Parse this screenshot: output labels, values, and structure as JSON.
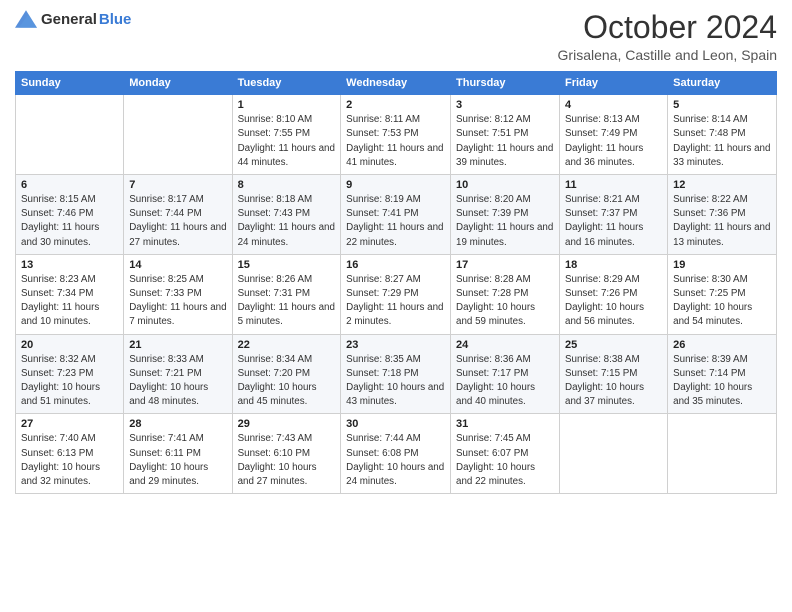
{
  "header": {
    "logo_general": "General",
    "logo_blue": "Blue",
    "month_title": "October 2024",
    "location": "Grisalena, Castille and Leon, Spain"
  },
  "weekdays": [
    "Sunday",
    "Monday",
    "Tuesday",
    "Wednesday",
    "Thursday",
    "Friday",
    "Saturday"
  ],
  "weeks": [
    [
      {
        "day": "",
        "info": ""
      },
      {
        "day": "",
        "info": ""
      },
      {
        "day": "1",
        "info": "Sunrise: 8:10 AM\nSunset: 7:55 PM\nDaylight: 11 hours and 44 minutes."
      },
      {
        "day": "2",
        "info": "Sunrise: 8:11 AM\nSunset: 7:53 PM\nDaylight: 11 hours and 41 minutes."
      },
      {
        "day": "3",
        "info": "Sunrise: 8:12 AM\nSunset: 7:51 PM\nDaylight: 11 hours and 39 minutes."
      },
      {
        "day": "4",
        "info": "Sunrise: 8:13 AM\nSunset: 7:49 PM\nDaylight: 11 hours and 36 minutes."
      },
      {
        "day": "5",
        "info": "Sunrise: 8:14 AM\nSunset: 7:48 PM\nDaylight: 11 hours and 33 minutes."
      }
    ],
    [
      {
        "day": "6",
        "info": "Sunrise: 8:15 AM\nSunset: 7:46 PM\nDaylight: 11 hours and 30 minutes."
      },
      {
        "day": "7",
        "info": "Sunrise: 8:17 AM\nSunset: 7:44 PM\nDaylight: 11 hours and 27 minutes."
      },
      {
        "day": "8",
        "info": "Sunrise: 8:18 AM\nSunset: 7:43 PM\nDaylight: 11 hours and 24 minutes."
      },
      {
        "day": "9",
        "info": "Sunrise: 8:19 AM\nSunset: 7:41 PM\nDaylight: 11 hours and 22 minutes."
      },
      {
        "day": "10",
        "info": "Sunrise: 8:20 AM\nSunset: 7:39 PM\nDaylight: 11 hours and 19 minutes."
      },
      {
        "day": "11",
        "info": "Sunrise: 8:21 AM\nSunset: 7:37 PM\nDaylight: 11 hours and 16 minutes."
      },
      {
        "day": "12",
        "info": "Sunrise: 8:22 AM\nSunset: 7:36 PM\nDaylight: 11 hours and 13 minutes."
      }
    ],
    [
      {
        "day": "13",
        "info": "Sunrise: 8:23 AM\nSunset: 7:34 PM\nDaylight: 11 hours and 10 minutes."
      },
      {
        "day": "14",
        "info": "Sunrise: 8:25 AM\nSunset: 7:33 PM\nDaylight: 11 hours and 7 minutes."
      },
      {
        "day": "15",
        "info": "Sunrise: 8:26 AM\nSunset: 7:31 PM\nDaylight: 11 hours and 5 minutes."
      },
      {
        "day": "16",
        "info": "Sunrise: 8:27 AM\nSunset: 7:29 PM\nDaylight: 11 hours and 2 minutes."
      },
      {
        "day": "17",
        "info": "Sunrise: 8:28 AM\nSunset: 7:28 PM\nDaylight: 10 hours and 59 minutes."
      },
      {
        "day": "18",
        "info": "Sunrise: 8:29 AM\nSunset: 7:26 PM\nDaylight: 10 hours and 56 minutes."
      },
      {
        "day": "19",
        "info": "Sunrise: 8:30 AM\nSunset: 7:25 PM\nDaylight: 10 hours and 54 minutes."
      }
    ],
    [
      {
        "day": "20",
        "info": "Sunrise: 8:32 AM\nSunset: 7:23 PM\nDaylight: 10 hours and 51 minutes."
      },
      {
        "day": "21",
        "info": "Sunrise: 8:33 AM\nSunset: 7:21 PM\nDaylight: 10 hours and 48 minutes."
      },
      {
        "day": "22",
        "info": "Sunrise: 8:34 AM\nSunset: 7:20 PM\nDaylight: 10 hours and 45 minutes."
      },
      {
        "day": "23",
        "info": "Sunrise: 8:35 AM\nSunset: 7:18 PM\nDaylight: 10 hours and 43 minutes."
      },
      {
        "day": "24",
        "info": "Sunrise: 8:36 AM\nSunset: 7:17 PM\nDaylight: 10 hours and 40 minutes."
      },
      {
        "day": "25",
        "info": "Sunrise: 8:38 AM\nSunset: 7:15 PM\nDaylight: 10 hours and 37 minutes."
      },
      {
        "day": "26",
        "info": "Sunrise: 8:39 AM\nSunset: 7:14 PM\nDaylight: 10 hours and 35 minutes."
      }
    ],
    [
      {
        "day": "27",
        "info": "Sunrise: 7:40 AM\nSunset: 6:13 PM\nDaylight: 10 hours and 32 minutes."
      },
      {
        "day": "28",
        "info": "Sunrise: 7:41 AM\nSunset: 6:11 PM\nDaylight: 10 hours and 29 minutes."
      },
      {
        "day": "29",
        "info": "Sunrise: 7:43 AM\nSunset: 6:10 PM\nDaylight: 10 hours and 27 minutes."
      },
      {
        "day": "30",
        "info": "Sunrise: 7:44 AM\nSunset: 6:08 PM\nDaylight: 10 hours and 24 minutes."
      },
      {
        "day": "31",
        "info": "Sunrise: 7:45 AM\nSunset: 6:07 PM\nDaylight: 10 hours and 22 minutes."
      },
      {
        "day": "",
        "info": ""
      },
      {
        "day": "",
        "info": ""
      }
    ]
  ]
}
